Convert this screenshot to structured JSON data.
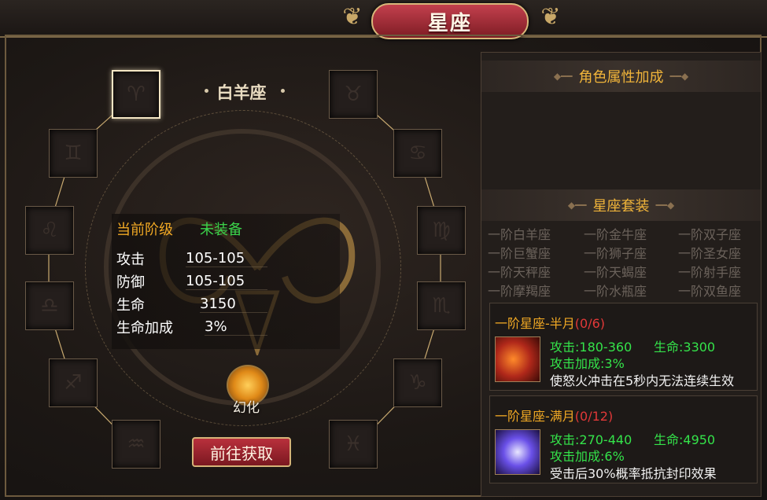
{
  "window": {
    "title": "星座"
  },
  "left": {
    "selected_sign": "白羊座",
    "grade_label": "当前阶级",
    "grade_value": "未装备",
    "stats": [
      {
        "label": "攻击",
        "value": "105-105"
      },
      {
        "label": "防御",
        "value": "105-105"
      },
      {
        "label": "生命",
        "value": "3150"
      },
      {
        "label": "生命加成",
        "value": "3%"
      }
    ],
    "morph_label": "幻化",
    "go_button": "前往获取"
  },
  "right": {
    "attr_header": "角色属性加成",
    "suit_header": "星座套装",
    "suits": [
      "一阶白羊座",
      "一阶金牛座",
      "一阶双子座",
      "一阶巨蟹座",
      "一阶狮子座",
      "一阶圣女座",
      "一阶天秤座",
      "一阶天蝎座",
      "一阶射手座",
      "一阶摩羯座",
      "一阶水瓶座",
      "一阶双鱼座"
    ],
    "sets": [
      {
        "title": "一阶星座-半月",
        "count": "(0/6)",
        "atk": "攻击:180-360",
        "hp": "生命:3300",
        "bonus": "攻击加成:3%",
        "effect": "使怒火冲击在5秒内无法连续生效"
      },
      {
        "title": "一阶星座-满月",
        "count": "(0/12)",
        "atk": "攻击:270-440",
        "hp": "生命:4950",
        "bonus": "攻击加成:6%",
        "effect": "受击后30%概率抵抗封印效果"
      }
    ]
  },
  "colors": {
    "accent": "#f0a824",
    "green": "#34e34a",
    "red": "#e23838",
    "title_plate": "#a52a35"
  }
}
